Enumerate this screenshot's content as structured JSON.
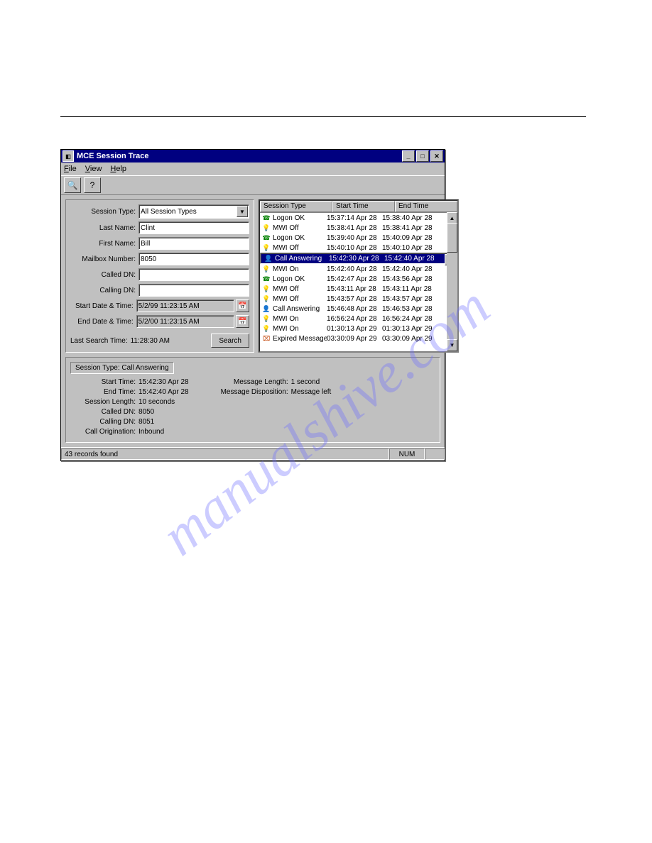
{
  "watermark": "manualshive.com",
  "window": {
    "title": "MCE Session Trace",
    "menu": {
      "file": "File",
      "view": "View",
      "help": "Help"
    }
  },
  "form": {
    "session_type_label": "Session Type:",
    "session_type_value": "All Session Types",
    "last_name_label": "Last Name:",
    "last_name_value": "Clint",
    "first_name_label": "First Name:",
    "first_name_value": "Bill",
    "mailbox_label": "Mailbox Number:",
    "mailbox_value": "8050",
    "called_dn_label": "Called DN:",
    "called_dn_value": "",
    "calling_dn_label": "Calling DN:",
    "calling_dn_value": "",
    "start_date_label": "Start Date & Time:",
    "start_date_value": "5/2/99 11:23:15 AM",
    "end_date_label": "End Date & Time:",
    "end_date_value": "5/2/00 11:23:15 AM",
    "last_search_label": "Last Search Time:",
    "last_search_value": "11:28:30 AM",
    "search_button": "Search"
  },
  "list": {
    "headers": {
      "c1": "Session Type",
      "c2": "Start Time",
      "c3": "End Time"
    },
    "rows": [
      {
        "icon": "phone",
        "type": "Logon OK",
        "start": "15:37:14 Apr 28",
        "end": "15:38:40 Apr 28"
      },
      {
        "icon": "bulb-off",
        "type": "MWI Off",
        "start": "15:38:41 Apr 28",
        "end": "15:38:41 Apr 28"
      },
      {
        "icon": "phone",
        "type": "Logon OK",
        "start": "15:39:40 Apr 28",
        "end": "15:40:09 Apr 28"
      },
      {
        "icon": "bulb-off",
        "type": "MWI Off",
        "start": "15:40:10 Apr 28",
        "end": "15:40:10 Apr 28"
      },
      {
        "icon": "call",
        "type": "Call Answering",
        "start": "15:42:30 Apr 28",
        "end": "15:42:40 Apr 28",
        "selected": true
      },
      {
        "icon": "bulb-on",
        "type": "MWI On",
        "start": "15:42:40 Apr 28",
        "end": "15:42:40 Apr 28"
      },
      {
        "icon": "phone",
        "type": "Logon OK",
        "start": "15:42:47 Apr 28",
        "end": "15:43:56 Apr 28"
      },
      {
        "icon": "bulb-off",
        "type": "MWI Off",
        "start": "15:43:11 Apr 28",
        "end": "15:43:11 Apr 28"
      },
      {
        "icon": "bulb-off",
        "type": "MWI Off",
        "start": "15:43:57 Apr 28",
        "end": "15:43:57 Apr 28"
      },
      {
        "icon": "call",
        "type": "Call Answering",
        "start": "15:46:48 Apr 28",
        "end": "15:46:53 Apr 28"
      },
      {
        "icon": "bulb-on",
        "type": "MWI On",
        "start": "16:56:24 Apr 28",
        "end": "16:56:24 Apr 28"
      },
      {
        "icon": "bulb-on",
        "type": "MWI On",
        "start": "01:30:13 Apr 29",
        "end": "01:30:13 Apr 29"
      },
      {
        "icon": "expired",
        "type": "Expired Messages",
        "start": "03:30:09 Apr 29",
        "end": "03:30:09 Apr 29"
      }
    ]
  },
  "detail": {
    "header": "Session Type: Call Answering",
    "start_time_label": "Start Time:",
    "start_time_value": "15:42:30 Apr 28",
    "end_time_label": "End Time:",
    "end_time_value": "15:42:40 Apr 28",
    "session_length_label": "Session Length:",
    "session_length_value": "10 seconds",
    "called_dn_label": "Called DN:",
    "called_dn_value": "8050",
    "calling_dn_label": "Calling DN:",
    "calling_dn_value": "8051",
    "origination_label": "Call Origination:",
    "origination_value": "Inbound",
    "msg_length_label": "Message Length:",
    "msg_length_value": "1 second",
    "msg_disp_label": "Message Disposition:",
    "msg_disp_value": "Message left"
  },
  "status": {
    "records": "43 records found",
    "num": "NUM"
  }
}
